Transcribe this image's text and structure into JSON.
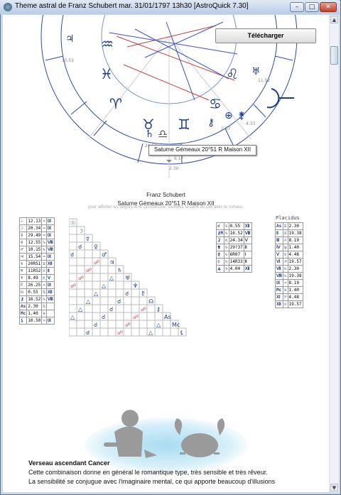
{
  "window": {
    "title": "Theme astral de Franz Schubert mar. 31/01/1797 13h30 [AstroQuick 7.30]",
    "min_label": "–",
    "max_label": "□",
    "close_label": "✕"
  },
  "download_button": {
    "label": "Télécharger"
  },
  "tooltip": {
    "text": "Saturne Gémeaux 20°51 R Maison XII"
  },
  "chart_labels": {
    "deg_1052": "10.52",
    "deg_1152": "11.52",
    "deg_257": "2.57",
    "deg_433": "4.33",
    "deg_2051": "20.51",
    "deg_230": "2.30",
    "deg_617": "6.17"
  },
  "person_name": "Franz Schubert",
  "selected_planet": "Saturne Gémeaux 20°51 R Maison XII",
  "hint": "pour afficher les degrés et le symbolisme, survolez la carte du ciel avec le curseur.",
  "placidus_label": "Placidus",
  "planets": [
    {
      "g": "☉",
      "s": "♒",
      "deg": "12.13",
      "h": "Ⅸ"
    },
    {
      "g": "☽",
      "s": "♒",
      "deg": "20.34",
      "h": "Ⅸ"
    },
    {
      "g": "☿",
      "s": "♒",
      "deg": "29.49",
      "h": "Ⅸ"
    },
    {
      "g": "♀",
      "s": "♑",
      "deg": "12.55",
      "h": "Ⅷ"
    },
    {
      "g": "♂",
      "s": "♑",
      "deg": "10.15",
      "h": "Ⅷ"
    },
    {
      "g": "♃",
      "s": "♒",
      "deg": "15.54",
      "h": "Ⅸ"
    },
    {
      "g": "♄",
      "s": "♊",
      "deg": "20R51",
      "h": "Ⅻ"
    },
    {
      "g": "♅",
      "s": "♌",
      "deg": "11R52",
      "h": "Ⅱ"
    },
    {
      "g": "♆",
      "s": "♏",
      "deg": "8.49",
      "h": "Ⅴ"
    },
    {
      "g": "♇",
      "s": "♒",
      "deg": "26.25",
      "h": "Ⅸ"
    },
    {
      "g": "☊",
      "s": "♋",
      "deg": "0.55",
      "h": "Ⅻ"
    },
    {
      "g": "⚷",
      "s": "♑",
      "deg": "16.52",
      "h": "Ⅷ"
    },
    {
      "g": "As",
      "s": "♋",
      "deg": "2.30",
      "h": ""
    },
    {
      "g": "Mc",
      "s": "♓",
      "deg": "1.40",
      "h": ""
    },
    {
      "g": "⚸",
      "s": "♒",
      "deg": "10.50",
      "h": "Ⅸ"
    }
  ],
  "aspect_labels": {
    "as": "As",
    "mc": "Mc"
  },
  "extras": [
    {
      "g": "☌",
      "s": "♑",
      "deg": "0.55",
      "h": "Ⅻ"
    },
    {
      "g": "⚷M",
      "s": "♑",
      "deg": "16.52",
      "h": "Ⅷ"
    },
    {
      "g": "⚳",
      "s": "♏",
      "deg": "24.34",
      "h": "Ⅴ"
    },
    {
      "g": "⚵",
      "s": "♑",
      "deg": "29?37",
      "h": "Ⅱ"
    },
    {
      "g": "⚴",
      "s": "♑",
      "deg": "6R07",
      "h": "Ⅰ"
    },
    {
      "g": "♀",
      "s": "♑",
      "deg": "14R33",
      "h": "Ⅱ"
    },
    {
      "g": "⚶",
      "s": "♑",
      "deg": "4.04",
      "h": "Ⅻ"
    }
  ],
  "houses": [
    {
      "h": "As",
      "s": "♋",
      "deg": "2.30"
    },
    {
      "h": "Ⅱ",
      "s": "♋",
      "deg": "19.38"
    },
    {
      "h": "Ⅲ",
      "s": "♌",
      "deg": "8.19"
    },
    {
      "h": "Ⅳ",
      "s": "♍",
      "deg": "1.40"
    },
    {
      "h": "Ⅴ",
      "s": "♏",
      "deg": "4.48"
    },
    {
      "h": "Ⅵ",
      "s": "♐",
      "deg": "19.57"
    },
    {
      "h": "Ⅶ",
      "s": "♑",
      "deg": "2.30"
    },
    {
      "h": "Ⅷ",
      "s": "♑",
      "deg": "19.38"
    },
    {
      "h": "Ⅸ",
      "s": "♒",
      "deg": "8.19"
    },
    {
      "h": "Mc",
      "s": "♓",
      "deg": "1.40"
    },
    {
      "h": "Ⅺ",
      "s": "♈",
      "deg": "4.48"
    },
    {
      "h": "Ⅻ",
      "s": "♉",
      "deg": "19.57"
    }
  ],
  "interpretation": {
    "title": "Verseau ascendant Cancer",
    "line1": "Cette combinaison donne en général le romantique type, très sensible et très rêveur.",
    "line2": "La sensibilité se conjugue avec l'imaginaire mental, ce qui apporte beaucoup d'illusions"
  },
  "colors": {
    "accent": "#1b3c8c",
    "aspect_red": "#c83c3c",
    "aspect_blue": "#3c50c8"
  }
}
